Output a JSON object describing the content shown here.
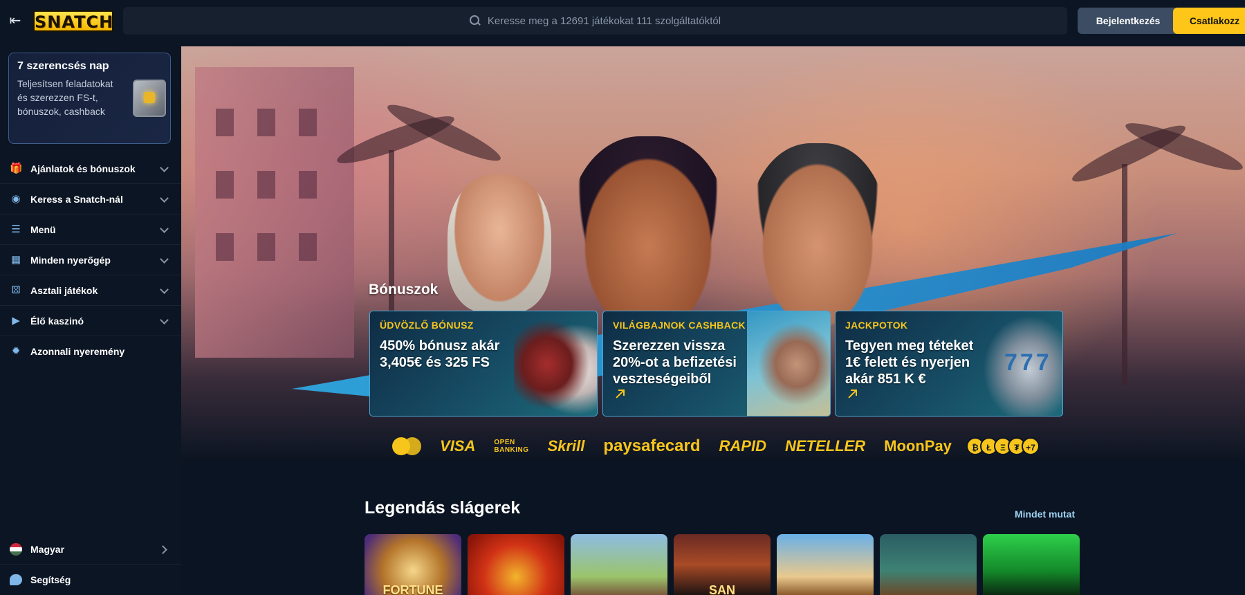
{
  "header": {
    "logo": "SNATCH",
    "search_placeholder": "Keresse meg a 12691 játékokat 111 szolgáltatóktól",
    "login_label": "Bejelentkezés",
    "join_label": "Csatlakozz"
  },
  "sidebar": {
    "promo": {
      "title": "7 szerencsés nap",
      "text": "Teljesítsen feladatokat és szerezzen FS-t, bónuszok, cashback"
    },
    "items": [
      {
        "label": "Ajánlatok és bónuszok",
        "icon": "gift-icon"
      },
      {
        "label": "Keress a Snatch-nál",
        "icon": "coins-icon"
      },
      {
        "label": "Menü",
        "icon": "menu-icon"
      },
      {
        "label": "Minden nyerőgép",
        "icon": "grid-icon"
      },
      {
        "label": "Asztali játékok",
        "icon": "dice-icon"
      },
      {
        "label": "Élő kaszinó",
        "icon": "play-icon"
      },
      {
        "label": "Azonnali nyeremény",
        "icon": "burst-icon"
      }
    ],
    "language": "Magyar",
    "help": "Segítség"
  },
  "bonuses": {
    "heading": "Bónuszok",
    "cards": [
      {
        "tag": "ÜDVÖZLŐ BÓNUSZ",
        "text": "450% bónusz akár 3,405€ és 325 FS"
      },
      {
        "tag": "VILÁGBAJNOK CASHBACK",
        "text": "Szerezzen vissza 20%-ot a befizetési veszteségeiből"
      },
      {
        "tag": "JACKPOTOK",
        "text": "Tegyen meg téteket 1€ felett és nyerjen akár 851 K €"
      }
    ]
  },
  "payments": {
    "visa": "VISA",
    "open_banking_1": "OPEN",
    "open_banking_2": "BANKING",
    "skrill": "Skrill",
    "paysafe": "paysafecard",
    "rapid": "RAPID",
    "neteller": "NETELLER",
    "moonpay": "MoonPay",
    "crypto_more": "+7"
  },
  "legendary": {
    "title": "Legendás slágerek",
    "show_all": "Mindet mutat",
    "games": [
      {
        "label": "FORTUNE"
      },
      {
        "label": ""
      },
      {
        "label": ""
      },
      {
        "label": "SAN"
      },
      {
        "label": ""
      },
      {
        "label": ""
      },
      {
        "label": ""
      }
    ]
  }
}
